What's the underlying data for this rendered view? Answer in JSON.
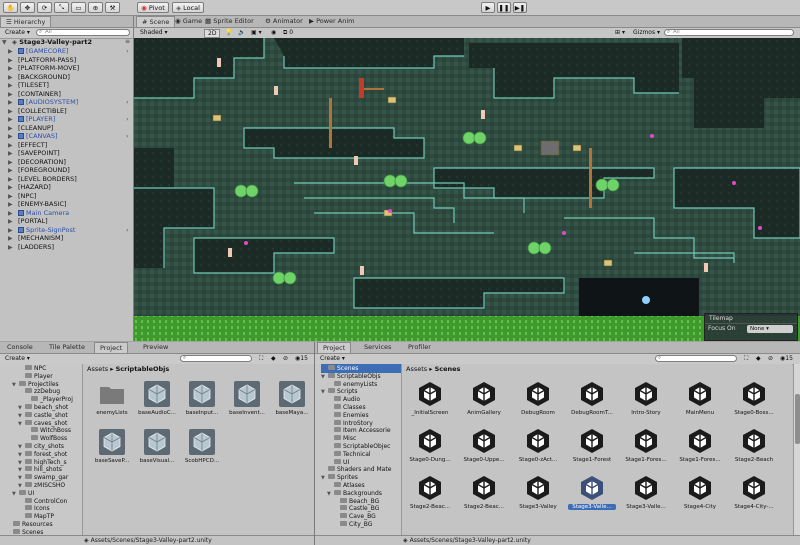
{
  "toolbar": {
    "tools": [
      "hand-tool",
      "move-tool",
      "rotate-tool",
      "scale-tool",
      "rect-tool",
      "transform-tool",
      "custom-tool"
    ],
    "pivot_label": "Pivot",
    "local_label": "Local",
    "play_icon": "play-icon",
    "pause_icon": "pause-icon",
    "step_icon": "step-icon"
  },
  "hierarchy": {
    "tab_label": "Hierarchy",
    "create_label": "Create",
    "search_placeholder": "All",
    "scene_name": "Stage3-Valley-part2",
    "items": [
      {
        "label": "[GAMECORE]",
        "blue": true,
        "arrow": true
      },
      {
        "label": "[PLATFORM-PASS]",
        "blue": false,
        "arrow": false
      },
      {
        "label": "[PLATFORM-MOVE]",
        "blue": false,
        "arrow": false
      },
      {
        "label": "[BACKGROUND]",
        "blue": false,
        "arrow": false
      },
      {
        "label": "[TILESET]",
        "blue": false,
        "arrow": false
      },
      {
        "label": "[CONTAINER]",
        "blue": false,
        "arrow": false
      },
      {
        "label": "[AUDIOSYSTEM]",
        "blue": true,
        "arrow": true
      },
      {
        "label": "[COLLECTIBLE]",
        "blue": false,
        "arrow": false
      },
      {
        "label": "[PLAYER]",
        "blue": true,
        "arrow": true
      },
      {
        "label": "[CLEANUP]",
        "blue": false,
        "arrow": false
      },
      {
        "label": "[CANVAS]",
        "blue": true,
        "arrow": true
      },
      {
        "label": "[EFFECT]",
        "blue": false,
        "arrow": false
      },
      {
        "label": "[SAVEPOINT]",
        "blue": false,
        "arrow": false
      },
      {
        "label": "[DECORATION]",
        "blue": false,
        "arrow": false
      },
      {
        "label": "[FOREGROUND]",
        "blue": false,
        "arrow": false
      },
      {
        "label": "[LEVEL BORDERS]",
        "blue": false,
        "arrow": false
      },
      {
        "label": "[HAZARD]",
        "blue": false,
        "arrow": false
      },
      {
        "label": "[NPC]",
        "blue": false,
        "arrow": false
      },
      {
        "label": "[ENEMY-BASIC]",
        "blue": false,
        "arrow": false
      },
      {
        "label": "Main Camera",
        "blue": true,
        "arrow": false
      },
      {
        "label": "[PORTAL]",
        "blue": false,
        "arrow": false
      },
      {
        "label": "Sprite-SignPost",
        "blue": true,
        "arrow": true
      },
      {
        "label": "[MECHANISM]",
        "blue": false,
        "arrow": false
      },
      {
        "label": "[LADDERS]",
        "blue": false,
        "arrow": false
      }
    ]
  },
  "scene_view": {
    "tabs": [
      "Scene",
      "Game",
      "Sprite Editor",
      "Animator",
      "Power Anim"
    ],
    "shading": "Shaded",
    "mode_2d": "2D",
    "gizmo_count": "0",
    "gizmos_label": "Gizmos",
    "search_placeholder": "All",
    "tilemap_panel_title": "Tilemap",
    "focus_on_label": "Focus On",
    "focus_on_value": "None"
  },
  "left_bottom": {
    "tabs": [
      "Console",
      "Tile Palette",
      "Project",
      "Preview"
    ],
    "create_label": "Create",
    "count": "15",
    "tree": [
      {
        "label": "NPC",
        "depth": 3,
        "arrow": false
      },
      {
        "label": "Player",
        "depth": 3,
        "arrow": false
      },
      {
        "label": "Projectiles",
        "depth": 2,
        "arrow": true
      },
      {
        "label": "zzDebug",
        "depth": 3,
        "arrow": false
      },
      {
        "label": "_PlayerProj",
        "depth": 4,
        "arrow": false
      },
      {
        "label": "beach_shot",
        "depth": 3,
        "arrow": true
      },
      {
        "label": "castle_shot",
        "depth": 3,
        "arrow": true
      },
      {
        "label": "caves_shot",
        "depth": 3,
        "arrow": true
      },
      {
        "label": "WitchBoss",
        "depth": 4,
        "arrow": false
      },
      {
        "label": "WolfBoss",
        "depth": 4,
        "arrow": false
      },
      {
        "label": "city_shots",
        "depth": 3,
        "arrow": true
      },
      {
        "label": "forest_shot",
        "depth": 3,
        "arrow": true
      },
      {
        "label": "highTech_s",
        "depth": 3,
        "arrow": true
      },
      {
        "label": "hill_shots",
        "depth": 3,
        "arrow": true
      },
      {
        "label": "swamp_gar",
        "depth": 3,
        "arrow": true
      },
      {
        "label": "zMISCSHO",
        "depth": 3,
        "arrow": true
      },
      {
        "label": "UI",
        "depth": 2,
        "arrow": true
      },
      {
        "label": "ControlCon",
        "depth": 3,
        "arrow": false
      },
      {
        "label": "Icons",
        "depth": 3,
        "arrow": false
      },
      {
        "label": "MapTP",
        "depth": 3,
        "arrow": false
      },
      {
        "label": "Resources",
        "depth": 1,
        "arrow": false
      },
      {
        "label": "Scenes",
        "depth": 1,
        "arrow": false
      }
    ],
    "breadcrumb": [
      "Assets",
      "ScriptableObjs"
    ],
    "assets": [
      {
        "label": "enemyLists",
        "type": "folder"
      },
      {
        "label": "baseAudioC...",
        "type": "so"
      },
      {
        "label": "baseInput...",
        "type": "so"
      },
      {
        "label": "baseInvent...",
        "type": "so"
      },
      {
        "label": "baseMaya...",
        "type": "so"
      },
      {
        "label": "baseSaveP...",
        "type": "so"
      },
      {
        "label": "baseVisual...",
        "type": "so"
      },
      {
        "label": "ScobHPCD...",
        "type": "so"
      }
    ],
    "status_path": "Assets/Scenes/Stage3-Valley-part2.unity"
  },
  "right_bottom": {
    "tabs": [
      "Project",
      "Services",
      "Profiler"
    ],
    "create_label": "Create",
    "count": "15",
    "tree": [
      {
        "label": "Scenes",
        "depth": 1,
        "arrow": false,
        "selected": true
      },
      {
        "label": "ScriptableObjs",
        "depth": 1,
        "arrow": true,
        "selected": false
      },
      {
        "label": "enemyLists",
        "depth": 2,
        "arrow": false,
        "selected": false
      },
      {
        "label": "Scripts",
        "depth": 1,
        "arrow": true,
        "selected": false
      },
      {
        "label": "Audio",
        "depth": 2,
        "arrow": false,
        "selected": false
      },
      {
        "label": "Classes",
        "depth": 2,
        "arrow": false,
        "selected": false
      },
      {
        "label": "Enemies",
        "depth": 2,
        "arrow": false,
        "selected": false
      },
      {
        "label": "IntroStory",
        "depth": 2,
        "arrow": false,
        "selected": false
      },
      {
        "label": "Item Accessorie",
        "depth": 2,
        "arrow": false,
        "selected": false
      },
      {
        "label": "Misc",
        "depth": 2,
        "arrow": false,
        "selected": false
      },
      {
        "label": "ScriptableObjec",
        "depth": 2,
        "arrow": false,
        "selected": false
      },
      {
        "label": "Technical",
        "depth": 2,
        "arrow": false,
        "selected": false
      },
      {
        "label": "UI",
        "depth": 2,
        "arrow": false,
        "selected": false
      },
      {
        "label": "Shaders and Mate",
        "depth": 1,
        "arrow": false,
        "selected": false
      },
      {
        "label": "Sprites",
        "depth": 1,
        "arrow": true,
        "selected": false
      },
      {
        "label": "Atlases",
        "depth": 2,
        "arrow": false,
        "selected": false
      },
      {
        "label": "Backgrounds",
        "depth": 2,
        "arrow": true,
        "selected": false
      },
      {
        "label": "Beach_BG",
        "depth": 3,
        "arrow": false,
        "selected": false
      },
      {
        "label": "Castle_BG",
        "depth": 3,
        "arrow": false,
        "selected": false
      },
      {
        "label": "Cave_BG",
        "depth": 3,
        "arrow": false,
        "selected": false
      },
      {
        "label": "City_BG",
        "depth": 3,
        "arrow": false,
        "selected": false
      }
    ],
    "breadcrumb": [
      "Assets",
      "Scenes"
    ],
    "scenes": [
      {
        "label": "_InitialScreen",
        "selected": false
      },
      {
        "label": "AnimGallery",
        "selected": false
      },
      {
        "label": "DebugRoom",
        "selected": false
      },
      {
        "label": "DebugRoomT...",
        "selected": false
      },
      {
        "label": "Intro-Story",
        "selected": false
      },
      {
        "label": "MainMenu",
        "selected": false
      },
      {
        "label": "Stage0-Boss...",
        "selected": false
      },
      {
        "label": "Stage0-Dung...",
        "selected": false
      },
      {
        "label": "Stage0-Uppe...",
        "selected": false
      },
      {
        "label": "Stage0-zAct...",
        "selected": false
      },
      {
        "label": "Stage1-Forest",
        "selected": false
      },
      {
        "label": "Stage1-Fores...",
        "selected": false
      },
      {
        "label": "Stage1-Fores...",
        "selected": false
      },
      {
        "label": "Stage2-Beach",
        "selected": false
      },
      {
        "label": "Stage2-Beac...",
        "selected": false
      },
      {
        "label": "Stage2-Beac...",
        "selected": false
      },
      {
        "label": "Stage3-Valley",
        "selected": false
      },
      {
        "label": "Stage3-Valle...",
        "selected": true
      },
      {
        "label": "Stage3-Valle...",
        "selected": false
      },
      {
        "label": "Stage4-City",
        "selected": false
      },
      {
        "label": "Stage4-City-...",
        "selected": false
      }
    ],
    "status_path": "Assets/Scenes/Stage3-Valley-part2.unity"
  }
}
